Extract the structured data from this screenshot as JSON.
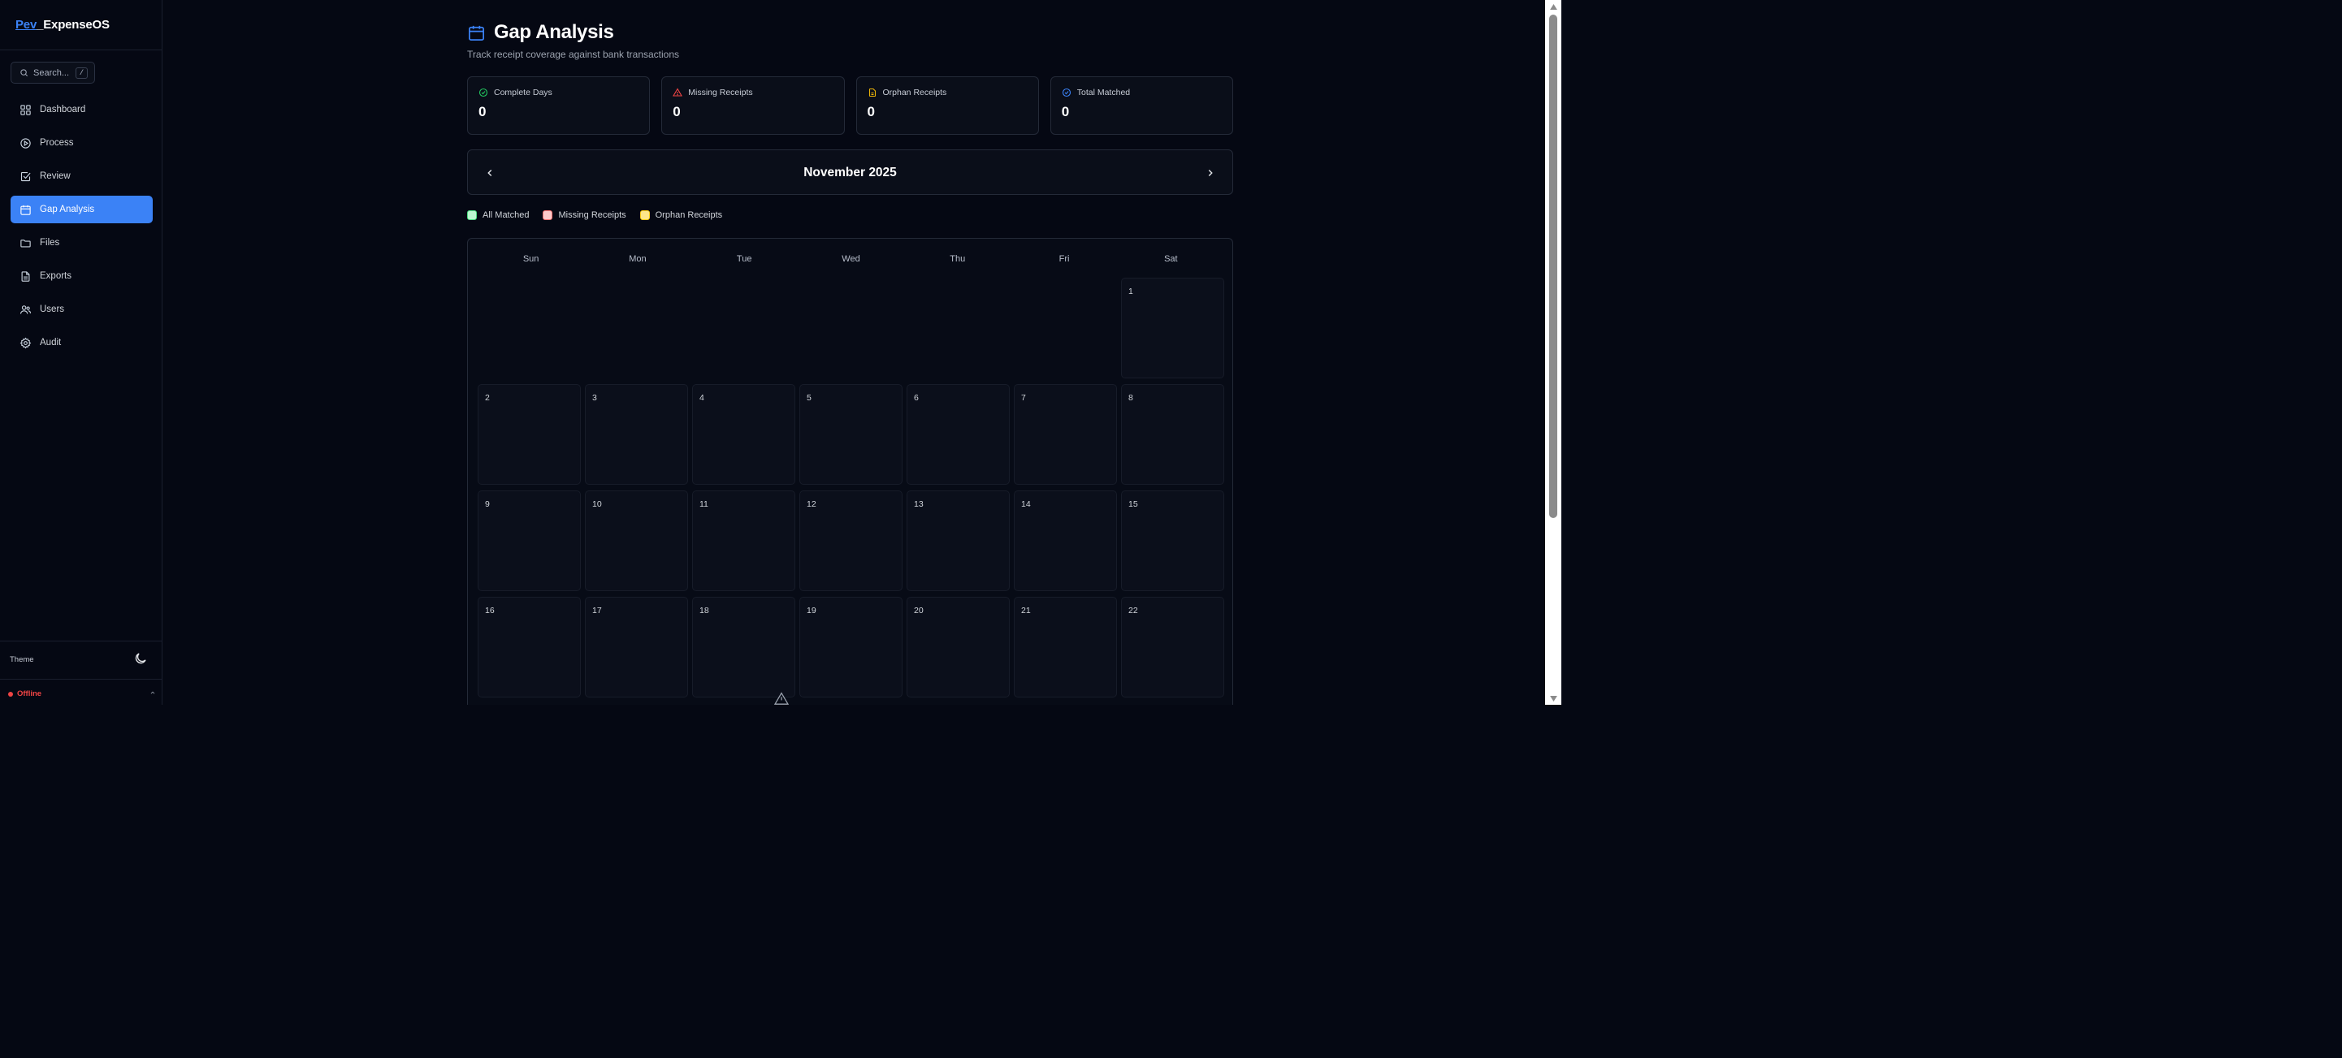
{
  "brand": {
    "prefix": "Pev",
    "sep": "_",
    "name": "ExpenseOS"
  },
  "search": {
    "placeholder": "Search...",
    "shortcut": "/"
  },
  "nav": [
    {
      "label": "Dashboard",
      "icon": "grid-icon"
    },
    {
      "label": "Process",
      "icon": "play-circle-icon"
    },
    {
      "label": "Review",
      "icon": "check-square-icon"
    },
    {
      "label": "Gap Analysis",
      "icon": "calendar-icon",
      "active": true
    },
    {
      "label": "Files",
      "icon": "folder-icon"
    },
    {
      "label": "Exports",
      "icon": "file-text-icon"
    },
    {
      "label": "Users",
      "icon": "users-icon"
    },
    {
      "label": "Audit",
      "icon": "gear-icon"
    }
  ],
  "theme": {
    "label": "Theme"
  },
  "status": {
    "label": "Offline",
    "color": "#ef4444"
  },
  "page": {
    "title": "Gap Analysis",
    "subtitle": "Track receipt coverage against bank transactions"
  },
  "stats": [
    {
      "label": "Complete Days",
      "value": "0",
      "icon": "check-circle-icon",
      "color": "#22c55e"
    },
    {
      "label": "Missing Receipts",
      "value": "0",
      "icon": "alert-triangle-icon",
      "color": "#ef4444"
    },
    {
      "label": "Orphan Receipts",
      "value": "0",
      "icon": "file-icon",
      "color": "#eab308"
    },
    {
      "label": "Total Matched",
      "value": "0",
      "icon": "check-circle-icon",
      "color": "#3b82f6"
    }
  ],
  "calendar": {
    "month_label": "November 2025",
    "weekdays": [
      "Sun",
      "Mon",
      "Tue",
      "Wed",
      "Thu",
      "Fri",
      "Sat"
    ],
    "weeks": [
      [
        "",
        "",
        "",
        "",
        "",
        "",
        "1"
      ],
      [
        "2",
        "3",
        "4",
        "5",
        "6",
        "7",
        "8"
      ],
      [
        "9",
        "10",
        "11",
        "12",
        "13",
        "14",
        "15"
      ],
      [
        "16",
        "17",
        "18",
        "19",
        "20",
        "21",
        "22"
      ]
    ]
  },
  "legend": [
    {
      "label": "All Matched",
      "color": "#bbf7d0"
    },
    {
      "label": "Missing Receipts",
      "color": "#fecaca"
    },
    {
      "label": "Orphan Receipts",
      "color": "#fde68a"
    }
  ],
  "colors": {
    "accent": "#3b82f6",
    "background": "#050813"
  }
}
